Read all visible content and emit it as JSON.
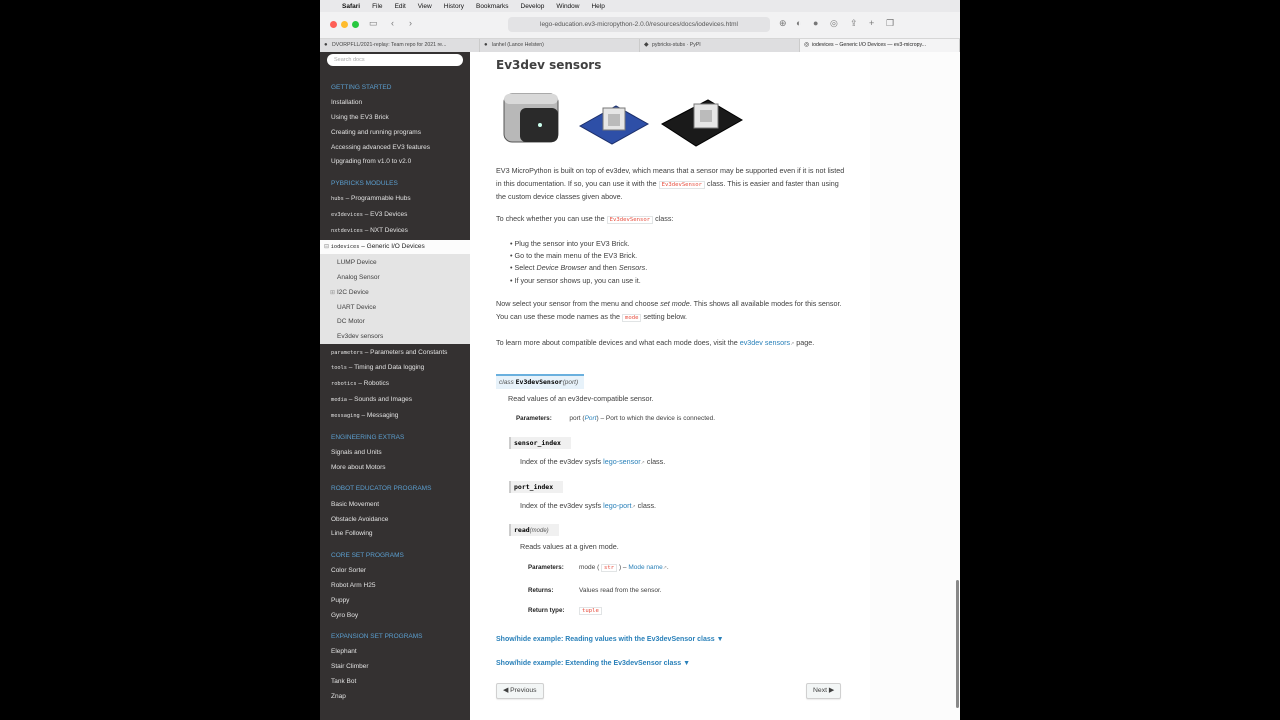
{
  "menubar": {
    "app": "Safari",
    "items": [
      "File",
      "Edit",
      "View",
      "History",
      "Bookmarks",
      "Develop",
      "Window",
      "Help"
    ]
  },
  "toolbar": {
    "url": "lego-education.ev3-micropython-2.0.0/resources/docs/iodevices.html"
  },
  "tabs": [
    {
      "label": "DVORPFLL/2021-replay: Team repo for 2021 re..."
    },
    {
      "label": "lanhel (Lance Helsten)"
    },
    {
      "label": "pybricks-stubs · PyPI"
    },
    {
      "label": "iodevices – Generic I/O Devices — ev3-micropy..."
    }
  ],
  "sidebar": {
    "search_placeholder": "Search docs",
    "s1": "GETTING STARTED",
    "getting_started": [
      "Installation",
      "Using the EV3 Brick",
      "Creating and running programs",
      "Accessing advanced EV3 features",
      "Upgrading from v1.0 to v2.0"
    ],
    "s2": "PYBRICKS MODULES",
    "modules": [
      {
        "code": "hubs",
        "text": " – Programmable Hubs"
      },
      {
        "code": "ev3devices",
        "text": " – EV3 Devices"
      },
      {
        "code": "nxtdevices",
        "text": " – NXT Devices"
      }
    ],
    "current": {
      "code": "iodevices",
      "text": " – Generic I/O Devices"
    },
    "subitems": [
      "LUMP Device",
      "Analog Sensor",
      "I2C Device",
      "UART Device",
      "DC Motor",
      "Ev3dev sensors"
    ],
    "modules2": [
      {
        "code": "parameters",
        "text": " – Parameters and Constants"
      },
      {
        "code": "tools",
        "text": " – Timing and Data logging"
      },
      {
        "code": "robotics",
        "text": " – Robotics"
      },
      {
        "code": "media",
        "text": " – Sounds and Images"
      },
      {
        "code": "messaging",
        "text": " – Messaging"
      }
    ],
    "s3": "ENGINEERING EXTRAS",
    "extras": [
      "Signals and Units",
      "More about Motors"
    ],
    "s4": "ROBOT EDUCATOR PROGRAMS",
    "robot": [
      "Basic Movement",
      "Obstacle Avoidance",
      "Line Following"
    ],
    "s5": "CORE SET PROGRAMS",
    "core": [
      "Color Sorter",
      "Robot Arm H25",
      "Puppy",
      "Gyro Boy"
    ],
    "s6": "EXPANSION SET PROGRAMS",
    "expansion": [
      "Elephant",
      "Stair Climber",
      "Tank Bot",
      "Znap"
    ]
  },
  "content": {
    "title": "Ev3dev sensors",
    "p1a": "EV3 MicroPython is built on top of ev3dev, which means that a sensor may be supported even if it is not listed in this documentation. If so, you can use it with the ",
    "p1code": "Ev3devSensor",
    "p1b": " class. This is easier and faster than using the custom device classes given above.",
    "p2a": "To check whether you can use the ",
    "p2code": "Ev3devSensor",
    "p2b": " class:",
    "li1": "Plug the sensor into your EV3 Brick.",
    "li2": "Go to the main menu of the EV3 Brick.",
    "li3a": "Select ",
    "li3b": "Device Browser",
    "li3c": " and then ",
    "li3d": "Sensors",
    "li3e": ".",
    "li4": "If your sensor shows up, you can use it.",
    "p3a": "Now select your sensor from the menu and choose ",
    "p3b": "set mode",
    "p3c": ". This shows all available modes for this sensor. You can use these mode names as the ",
    "p3code": "mode",
    "p3d": " setting below.",
    "p4a": "To learn more about compatible devices and what each mode does, visit the ",
    "p4link": "ev3dev sensors",
    "p4b": " page.",
    "sig_class": "class",
    "sig_name": "Ev3devSensor",
    "sig_args": "(port)",
    "sig_desc": "Read values of an ev3dev-compatible sensor.",
    "params_label": "Parameters:",
    "param_port": "port",
    "param_port_type": "Port",
    "param_port_desc": " – Port to which the device is connected.",
    "attr1": "sensor_index",
    "attr1_desc_a": "Index of the ev3dev sysfs ",
    "attr1_link": "lego-sensor",
    "attr1_desc_b": " class.",
    "attr2": "port_index",
    "attr2_desc_a": "Index of the ev3dev sysfs ",
    "attr2_link": "lego-port",
    "attr2_desc_b": " class.",
    "m_name": "read",
    "m_args": "(mode)",
    "m_desc": "Reads values at a given mode.",
    "m_params_label": "Parameters:",
    "m_param": "mode",
    "m_param_type": "str",
    "m_param_link": "Mode name",
    "m_returns_label": "Returns:",
    "m_returns": "Values read from the sensor.",
    "m_rtype_label": "Return type:",
    "m_rtype": "tuple",
    "toggle1": "Show/hide example: Reading values with the Ev3devSensor class ▼",
    "toggle2": "Show/hide example: Extending the Ev3devSensor class ▼",
    "prev": "Previous",
    "next": "Next"
  }
}
